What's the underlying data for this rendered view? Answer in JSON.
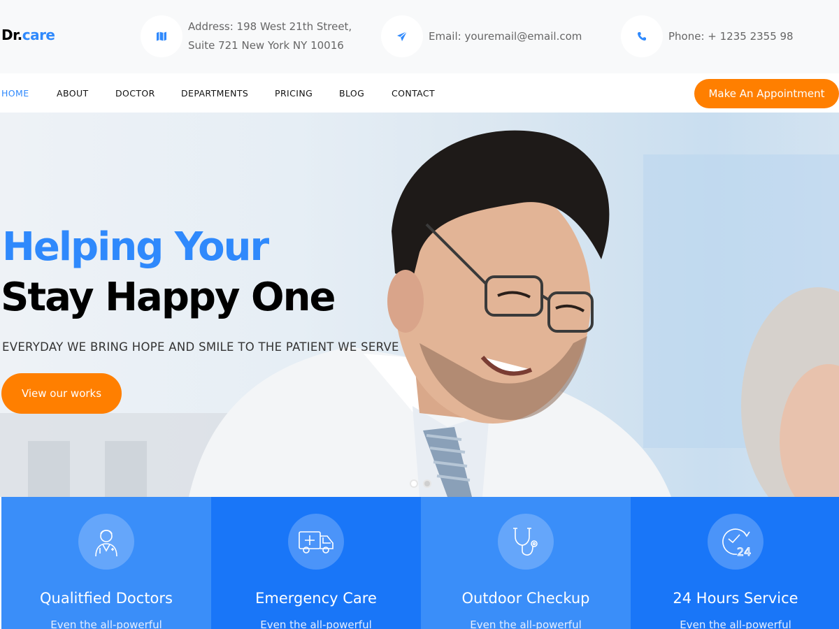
{
  "brand": {
    "part1": "Dr.",
    "part2": "care"
  },
  "contact": {
    "address_line1": "Address: 198 West 21th Street,",
    "address_line2": "Suite 721 New York NY 10016",
    "email": "Email: youremail@email.com",
    "phone": "Phone: + 1235 2355 98"
  },
  "nav": {
    "items": [
      "HOME",
      "ABOUT",
      "DOCTOR",
      "DEPARTMENTS",
      "PRICING",
      "BLOG",
      "CONTACT"
    ],
    "active": "HOME",
    "cta_label": "Make An Appointment"
  },
  "hero": {
    "title_line1": "Helping Your",
    "title_line2": "Stay Happy One",
    "subtitle": "EVERYDAY WE BRING HOPE AND SMILE TO THE PATIENT WE SERVE",
    "button_label": "View our works",
    "slide_count": 2,
    "active_slide": 1
  },
  "services": [
    {
      "title": "Qualitfied Doctors",
      "desc": "Even the all-powerful",
      "icon": "doctor-icon",
      "bg": "#3a8ef9"
    },
    {
      "title": "Emergency Care",
      "desc": "Even the all-powerful",
      "icon": "ambulance-icon",
      "bg": "#1976f8"
    },
    {
      "title": "Outdoor Checkup",
      "desc": "Even the all-powerful",
      "icon": "stethoscope-icon",
      "bg": "#3a8ef9"
    },
    {
      "title": "24 Hours Service",
      "desc": "Even the all-powerful",
      "icon": "clock-24-icon",
      "bg": "#1976f8"
    }
  ],
  "colors": {
    "accent": "#2f89fc",
    "cta": "#ff7f00",
    "service_light": "#3a8ef9",
    "service_dark": "#1976f8"
  }
}
